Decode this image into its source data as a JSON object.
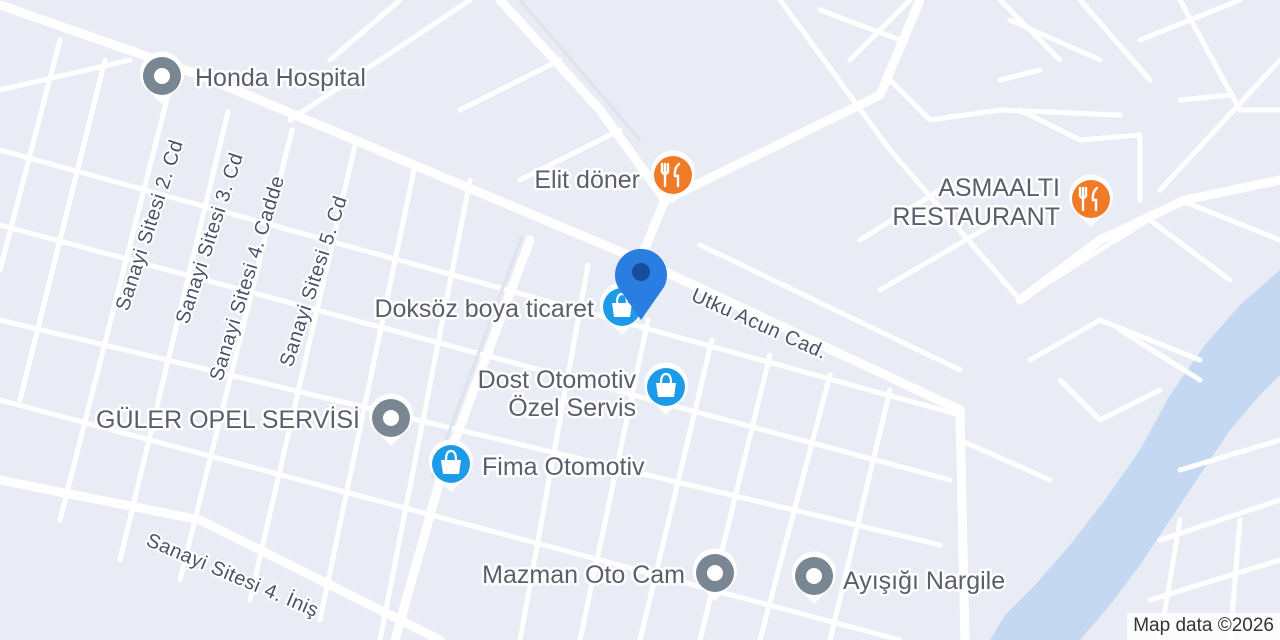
{
  "map": {
    "colors": {
      "land": "#e9ecf4",
      "road": "#ffffff",
      "water": "#c4d8f2",
      "label_text": "#4a5468",
      "poi_text": "#5a5f6b",
      "generic_pin": "#7b8693",
      "food_pin": "#f07a26",
      "shopping_pin": "#1e9be8",
      "location_marker": "#2a7de1"
    },
    "streets": {
      "utku_acun": "Utku Acun Cad.",
      "sanayi_2": "Sanayi Sitesi 2. Cd",
      "sanayi_3": "Sanayi Sitesi 3. Cd",
      "sanayi_4": "Sanayi Sitesi 4. Cadde",
      "sanayi_5": "Sanayi Sitesi 5. Cd",
      "sanayi_inis": "Sanayi Sitesi 4. İniş"
    },
    "places": {
      "honda_hospital": {
        "name": "Honda Hospital",
        "icon": "generic-pin-icon"
      },
      "elit_doner": {
        "name": "Elit döner",
        "icon": "restaurant-pin-icon"
      },
      "asmaalti_line1": "ASMAALTI",
      "asmaalti_line2": "RESTAURANT",
      "asmaalti_icon": "restaurant-pin-icon",
      "doksoz": {
        "name": "Doksöz boya ticaret",
        "icon": "shopping-pin-icon"
      },
      "dost_line1": "Dost Otomotiv",
      "dost_line2": "Özel Servis",
      "dost_icon": "shopping-pin-icon",
      "guler": {
        "name": "GÜLER OPEL SERVİSİ",
        "icon": "generic-pin-icon"
      },
      "fima": {
        "name": "Fima Otomotiv",
        "icon": "shopping-pin-icon"
      },
      "mazman": {
        "name": "Mazman Oto Cam",
        "icon": "generic-pin-icon"
      },
      "aysigi": {
        "name": "Ayışığı Nargile",
        "icon": "generic-pin-icon"
      }
    },
    "attribution": "Map data ©2026"
  }
}
